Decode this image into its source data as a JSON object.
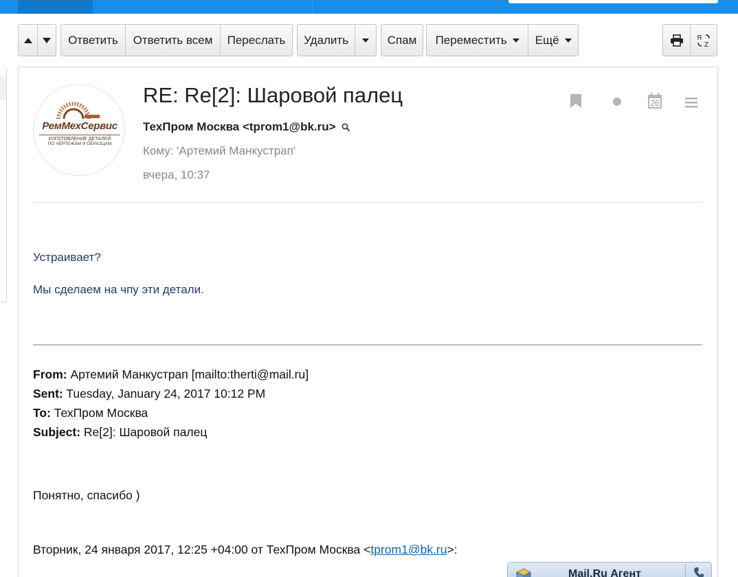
{
  "toolbar": {
    "reply": "Ответить",
    "reply_all": "Ответить всем",
    "forward": "Переслать",
    "delete": "Удалить",
    "spam": "Спам",
    "move": "Переместить",
    "more": "Ещё"
  },
  "message": {
    "subject": "RE: Re[2]: Шаровой палец",
    "sender": "ТехПром Москва <tprom1@bk.ru>",
    "to": "Кому: 'Артемий Манкустрап'",
    "date": "вчера, 10:37",
    "calendar_day": "26",
    "avatar": {
      "brand": "РемМехСервис",
      "tagline_1": "ИЗГОТОВЛЕНИЕ ДЕТАЛЕЙ",
      "tagline_2": "ПО ЧЕРТЕЖАМ И ОБРАЗЦАМ"
    }
  },
  "body": {
    "line1": "Устраивает?",
    "line2": "Мы сделаем на чпу эти детали.",
    "quote": {
      "from_label": "From:",
      "from_value": "Артемий Манкустрап [mailto:therti@mail.ru]",
      "sent_label": "Sent:",
      "sent_value": "Tuesday, January 24, 2017 10:12 PM",
      "to_label": "To:",
      "to_value": "ТехПром Москва",
      "subject_label": "Subject:",
      "subject_value": "Re[2]: Шаровой палец"
    },
    "reply_text": "Понятно, спасибо )",
    "attribution_prefix": "Вторник, 24 января 2017, 12:25 +04:00 от ТехПром Москва <",
    "attribution_link": "tprom1@bk.ru",
    "attribution_suffix": ">:"
  },
  "agent": {
    "label": "Mail.Ru Агент"
  }
}
